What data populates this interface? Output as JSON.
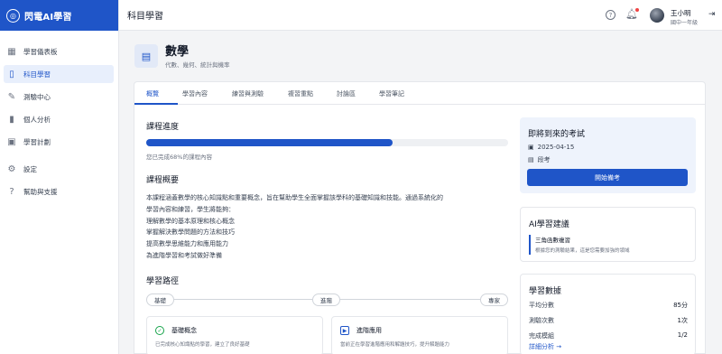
{
  "app": {
    "title": "閃電AI學習"
  },
  "sidebar": {
    "items": [
      {
        "label": "學習儀表板",
        "icon": "dashboard-icon",
        "glyph": "▦"
      },
      {
        "label": "科目學習",
        "icon": "book-icon",
        "glyph": "▯"
      },
      {
        "label": "測驗中心",
        "icon": "pencil-icon",
        "glyph": "✎"
      },
      {
        "label": "個人分析",
        "icon": "bar-chart-icon",
        "glyph": "▮"
      },
      {
        "label": "學習計劃",
        "icon": "calendar-icon",
        "glyph": "▣"
      }
    ],
    "bottom_items": [
      {
        "label": "設定",
        "icon": "gear-icon",
        "glyph": "⚙"
      },
      {
        "label": "幫助與支援",
        "icon": "help-icon",
        "glyph": "?"
      }
    ]
  },
  "header": {
    "title": "科目學習",
    "user": {
      "name": "王小明",
      "grade": "國中一年級"
    }
  },
  "subject": {
    "name": "數學",
    "description": "代數、幾何、統計與機率"
  },
  "tabs": [
    "概覽",
    "學習內容",
    "練習與測驗",
    "複習重點",
    "討論區",
    "學習筆記"
  ],
  "progress": {
    "title": "課程進度",
    "percent": 68,
    "text": "您已完成68%的課程內容"
  },
  "overview": {
    "title": "課程概要",
    "lines": [
      "本課程涵蓋數學的核心知識點和重要概念，旨在幫助學生全面掌握該學科的基礎知識和技能。通過系統化的",
      "學習內容和練習，學生將能夠：",
      "理解數學的基本原理和核心概念",
      "掌握解決數學問題的方法和技巧",
      "提高數學思維能力和應用能力",
      "為進階學習和考試做好準備"
    ]
  },
  "learning_path": {
    "title": "學習路徑",
    "levels": [
      "基礎",
      "進階",
      "專家"
    ],
    "steps": [
      {
        "title": "基礎概念",
        "desc": "已完成核心知識點的學習，建立了良好基礎",
        "icon": "check-icon"
      },
      {
        "title": "進階應用",
        "desc": "當前正在學習進階應用和解題技巧，提升解題能力",
        "icon": "play-icon"
      }
    ]
  },
  "upcoming_exam": {
    "title": "即將到來的考試",
    "date": "2025-04-15",
    "type": "段考",
    "button": "開始備考"
  },
  "ai_advice": {
    "title": "AI學習建議",
    "item_title": "三角函數複習",
    "item_desc": "根據您的測驗結果，這是您需要加強的領域"
  },
  "stats": {
    "title": "學習數據",
    "rows": [
      {
        "label": "平均分數",
        "value": "85分"
      },
      {
        "label": "測驗次數",
        "value": "1次"
      },
      {
        "label": "完成模組",
        "value": "1/2"
      }
    ],
    "more": "詳細分析 →"
  },
  "colors": {
    "primary": "#1f55c8",
    "sidebar_active": "#e8effc",
    "notification": "#ef4444"
  }
}
